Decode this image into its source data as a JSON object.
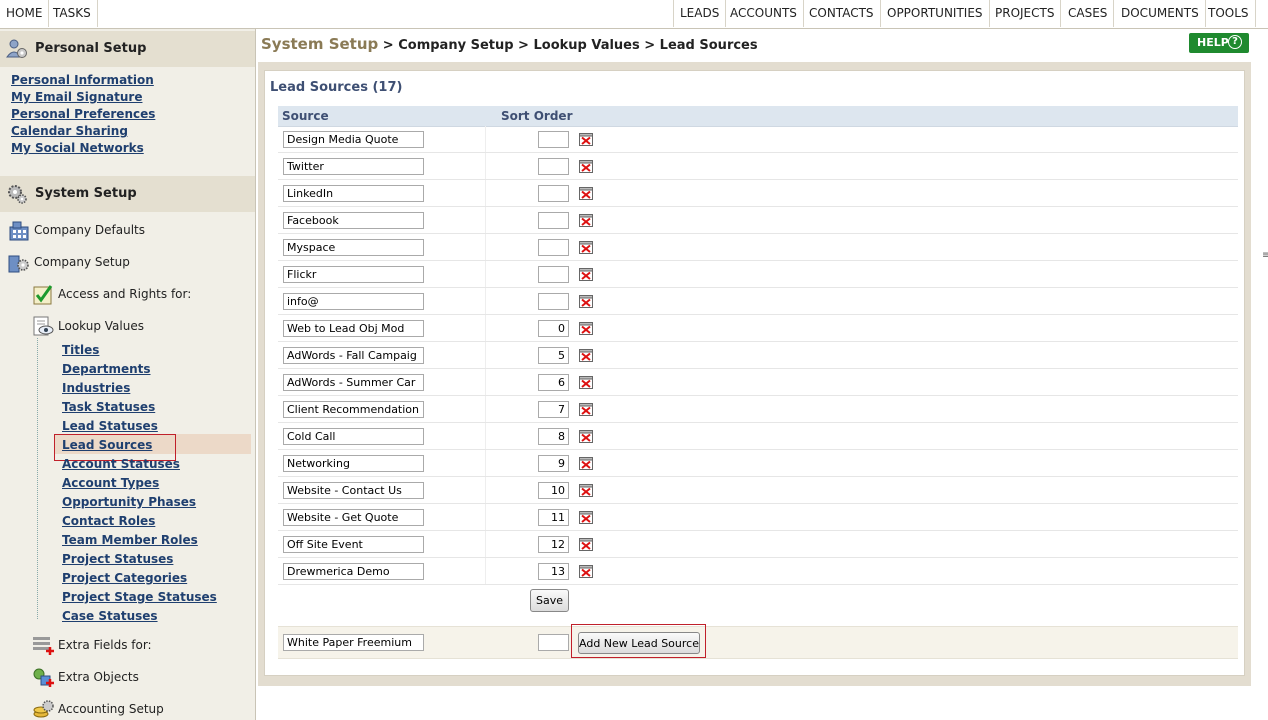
{
  "topnav": {
    "left": [
      "HOME",
      "TASKS"
    ],
    "right": [
      "LEADS",
      "ACCOUNTS",
      "CONTACTS",
      "OPPORTUNITIES",
      "PROJECTS",
      "CASES",
      "DOCUMENTS",
      "TOOLS"
    ]
  },
  "sidebar": {
    "personal_setup_title": "Personal Setup",
    "personal_links": [
      "Personal Information",
      "My Email Signature",
      "Personal Preferences",
      "Calendar Sharing",
      "My Social Networks"
    ],
    "system_setup_title": "System Setup",
    "company_defaults": "Company Defaults",
    "company_setup": "Company Setup",
    "access_rights": "Access and Rights for:",
    "lookup_values": "Lookup Values",
    "lookup_links": [
      "Titles",
      "Departments",
      "Industries",
      "Task Statuses",
      "Lead Statuses",
      "Lead Sources",
      "Account Statuses",
      "Account Types",
      "Opportunity Phases",
      "Contact Roles",
      "Team Member Roles",
      "Project Statuses",
      "Project Categories",
      "Project Stage Statuses",
      "Case Statuses"
    ],
    "active_lookup": "Lead Sources",
    "extra_fields": "Extra Fields for:",
    "extra_objects": "Extra Objects",
    "accounting_setup": "Accounting Setup"
  },
  "breadcrumb": {
    "root": "System Setup",
    "rest": " > Company Setup > Lookup Values > Lead Sources"
  },
  "help_label": "HELP",
  "panel": {
    "title": "Lead Sources (17)",
    "col_source": "Source",
    "col_sort": "Sort Order",
    "rows": [
      {
        "source": "Design Media Quote",
        "order": ""
      },
      {
        "source": "Twitter",
        "order": ""
      },
      {
        "source": "LinkedIn",
        "order": ""
      },
      {
        "source": "Facebook",
        "order": ""
      },
      {
        "source": "Myspace",
        "order": ""
      },
      {
        "source": "Flickr",
        "order": ""
      },
      {
        "source": "info@",
        "order": ""
      },
      {
        "source": "Web to Lead Obj Mod",
        "order": "0"
      },
      {
        "source": "AdWords - Fall Campaig",
        "order": "5"
      },
      {
        "source": "AdWords - Summer Car",
        "order": "6"
      },
      {
        "source": "Client Recommendation",
        "order": "7"
      },
      {
        "source": "Cold Call",
        "order": "8"
      },
      {
        "source": "Networking",
        "order": "9"
      },
      {
        "source": "Website - Contact Us",
        "order": "10"
      },
      {
        "source": "Website - Get Quote",
        "order": "11"
      },
      {
        "source": "Off Site Event",
        "order": "12"
      },
      {
        "source": "Drewmerica Demo",
        "order": "13"
      }
    ],
    "save_label": "Save",
    "new_source_value": "White Paper Freemium",
    "new_order_value": "",
    "add_label": "Add New Lead Source"
  },
  "colors": {
    "accent_green": "#1f8a2f",
    "highlight_red": "#c0202a",
    "link": "#1f3f6f"
  }
}
